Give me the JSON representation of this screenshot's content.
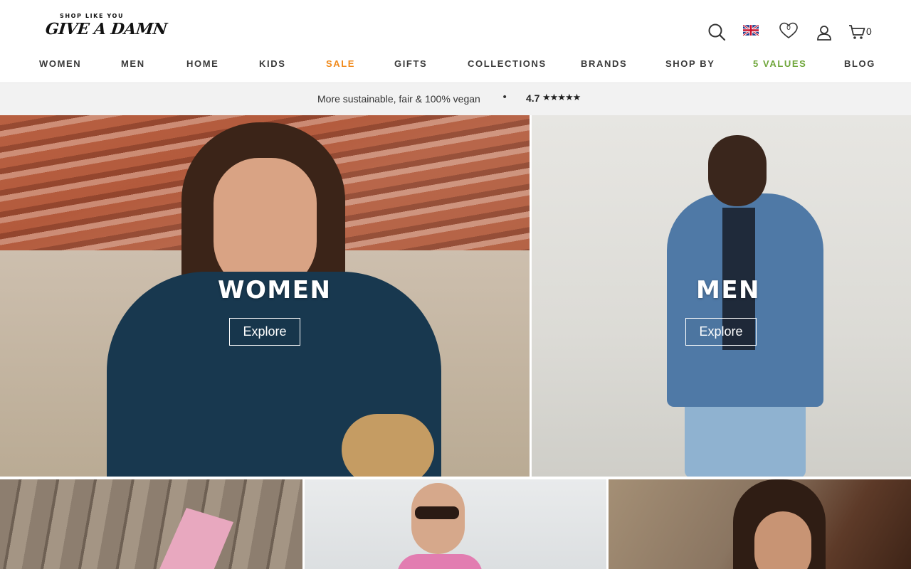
{
  "brand": {
    "tagline": "SHOP LIKE YOU",
    "name": "GIVE A DAMN"
  },
  "header": {
    "wishlist_count": "0",
    "cart_count": "0"
  },
  "nav": {
    "items": [
      {
        "label": "WOMEN"
      },
      {
        "label": "MEN"
      },
      {
        "label": "HOME"
      },
      {
        "label": "KIDS"
      },
      {
        "label": "SALE"
      },
      {
        "label": "GIFTS"
      },
      {
        "label": "COLLECTIONS"
      },
      {
        "label": "BRANDS"
      },
      {
        "label": "SHOP BY"
      },
      {
        "label": "5 VALUES"
      },
      {
        "label": "BLOG"
      }
    ]
  },
  "promo": {
    "text": "More sustainable, fair & 100% vegan",
    "separator": "•",
    "rating": "4.7",
    "stars": "★★★★★"
  },
  "hero": {
    "women": {
      "title": "WOMEN",
      "button": "Explore"
    },
    "men": {
      "title": "MEN",
      "button": "Explore"
    }
  },
  "colors": {
    "sale": "#f08a1c",
    "values": "#6fa63a",
    "strip_bg": "#f2f2f2"
  }
}
